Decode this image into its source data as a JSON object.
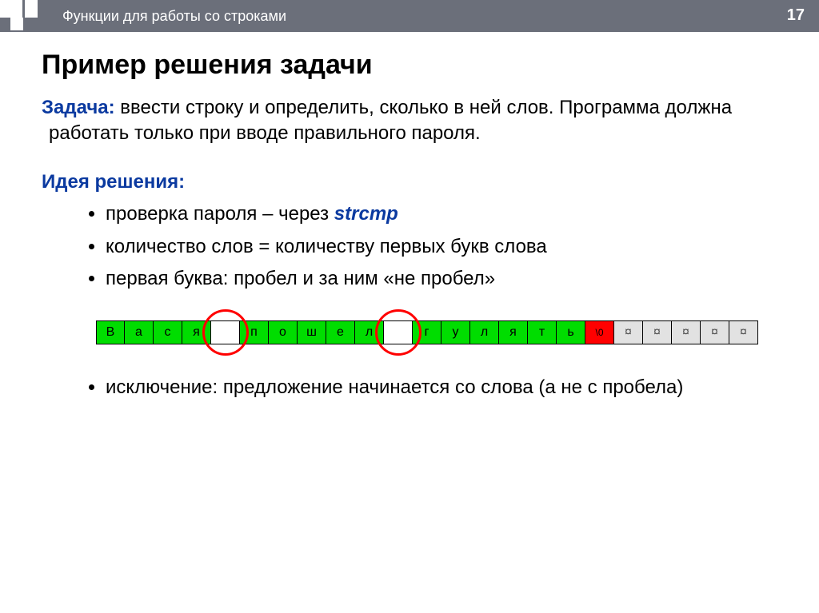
{
  "header": {
    "topic": "Функции для работы со строками",
    "page_number": "17"
  },
  "title": "Пример решения задачи",
  "task": {
    "label": "Задача:",
    "text": " ввести строку и определить, сколько в ней слов. Программа должна работать только при вводе правильного пароля."
  },
  "idea": {
    "label": "Идея решения:",
    "items": [
      {
        "text_before": "проверка пароля – через ",
        "code": "strcmp",
        "text_after": ""
      },
      {
        "text_before": "количество слов = количеству первых букв слова",
        "code": "",
        "text_after": ""
      },
      {
        "text_before": "первая буква: пробел и за ним «не пробел»",
        "code": "",
        "text_after": ""
      }
    ],
    "item_after": "исключение: предложение начинается со слова (а не с пробела)"
  },
  "boxes": {
    "cells": [
      {
        "char": "В",
        "cls": "green"
      },
      {
        "char": "а",
        "cls": "green"
      },
      {
        "char": "с",
        "cls": "green"
      },
      {
        "char": "я",
        "cls": "green"
      },
      {
        "char": " ",
        "cls": "white"
      },
      {
        "char": "п",
        "cls": "green"
      },
      {
        "char": "о",
        "cls": "green"
      },
      {
        "char": "ш",
        "cls": "green"
      },
      {
        "char": "е",
        "cls": "green"
      },
      {
        "char": "л",
        "cls": "green"
      },
      {
        "char": " ",
        "cls": "white"
      },
      {
        "char": "г",
        "cls": "green"
      },
      {
        "char": "у",
        "cls": "green"
      },
      {
        "char": "л",
        "cls": "green"
      },
      {
        "char": "я",
        "cls": "green"
      },
      {
        "char": "т",
        "cls": "green"
      },
      {
        "char": "ь",
        "cls": "green"
      },
      {
        "char": "\\0",
        "cls": "red"
      },
      {
        "char": "¤",
        "cls": "gray"
      },
      {
        "char": "¤",
        "cls": "gray"
      },
      {
        "char": "¤",
        "cls": "gray"
      },
      {
        "char": "¤",
        "cls": "gray"
      },
      {
        "char": "¤",
        "cls": "gray"
      }
    ],
    "circles": [
      4.5,
      10.5
    ]
  }
}
